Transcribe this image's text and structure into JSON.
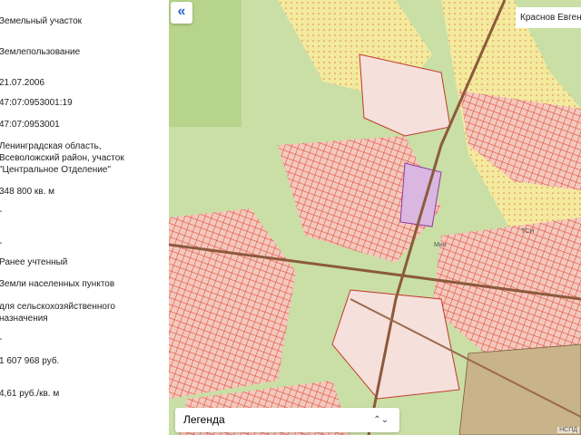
{
  "panel": {
    "values": [
      "Земельный участок",
      "Землепользование",
      "21.07.2006",
      "47:07:0953001:19",
      "47:07:0953001",
      "Ленинградская область,\nВсеволожский район, участок\n\"Центральное Отделение\"",
      "348 800 кв. м",
      "-",
      "-",
      "Ранее учтенный",
      "Земли населенных пунктов",
      "для сельскохозяйственного\nназначения",
      "-",
      "1 607 968 руб.",
      "4,61 руб./кв. м"
    ]
  },
  "map": {
    "collapse_icon": "«",
    "user_name": "Краснов Евгений",
    "legend_label": "Легенда",
    "legend_chevron": "⌃⌄",
    "attribution": "НСПД",
    "labels": [
      "ТСН",
      "Мин"
    ],
    "colors": {
      "green": "#c9dfa6",
      "parcel": "#e0503f",
      "yellow": "#f3ea9e",
      "selected": "#d9b7e0",
      "road": "#8b5a3c"
    }
  }
}
